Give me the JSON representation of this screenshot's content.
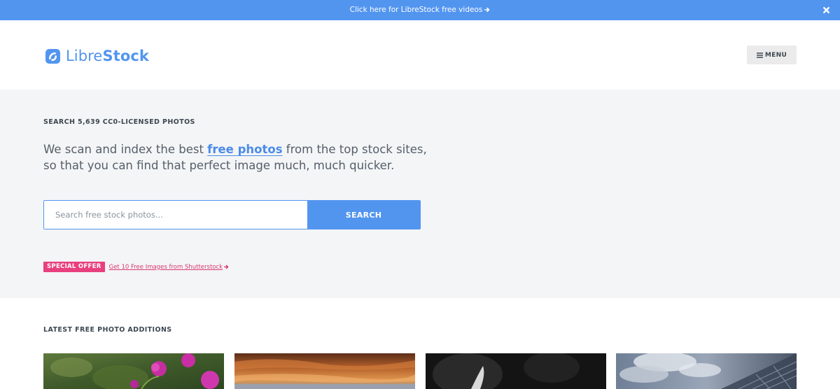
{
  "banner": {
    "text": "Click here for LibreStock free videos",
    "close_icon": "close-icon",
    "arrow_icon": "arrow-right-icon",
    "color": "#5295ef"
  },
  "header": {
    "logo_light": "Libre",
    "logo_bold": "Stock",
    "logo_icon": "librestock-logo-icon",
    "menu_label": "MENU",
    "menu_icon": "hamburger-icon"
  },
  "hero": {
    "eyebrow": "SEARCH 5,639 CC0-LICENSED PHOTOS",
    "tagline_before": "We scan and index the best ",
    "tagline_link": "free photos",
    "tagline_after": " from the top stock sites, so that you can find that perfect image much, much quicker.",
    "search": {
      "placeholder": "Search free stock photos...",
      "value": "",
      "button_label": "SEARCH"
    },
    "offer": {
      "badge": "SPECIAL OFFER",
      "link_text": "Get 10 Free Images from Shutterstock",
      "badge_color": "#e8407e"
    }
  },
  "latest": {
    "title": "LATEST FREE PHOTO ADDITIONS",
    "photos": [
      {
        "subject": "pink flowers"
      },
      {
        "subject": "orange rock canyon"
      },
      {
        "subject": "dark close-up"
      },
      {
        "subject": "clouds and glass building"
      }
    ]
  },
  "colors": {
    "accent": "#5295ef",
    "hero_background": "#f4f5f6",
    "offer_pink": "#e8407e"
  }
}
